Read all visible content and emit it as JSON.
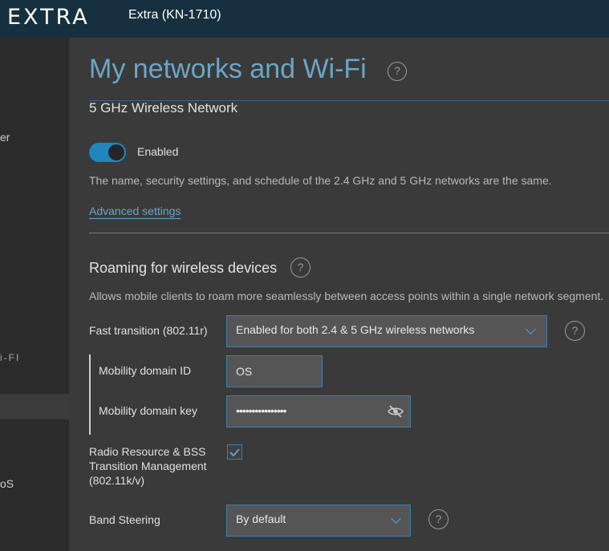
{
  "header": {
    "logo": "EXTRA",
    "device": "Extra (KN-1710)"
  },
  "sidebar": {
    "items": [
      {
        "label": "er"
      },
      {
        "label": "i-FI"
      },
      {
        "label": "oS"
      }
    ]
  },
  "page": {
    "title": "My networks and Wi-Fi",
    "help_icon": "?",
    "subtitle": "5 GHz Wireless Network"
  },
  "network": {
    "enabled": true,
    "toggle_label": "Enabled",
    "note": "The name, security settings, and schedule of the 2.4 GHz and 5 GHz networks are the same.",
    "advanced_link": "Advanced settings"
  },
  "roaming": {
    "title": "Roaming for wireless devices",
    "description": "Allows mobile clients to roam more seamlessly between access points within a single network segment.",
    "fast_transition": {
      "label": "Fast transition (802.11r)",
      "value": "Enabled for both 2.4 & 5 GHz wireless networks"
    },
    "mobility_domain_id": {
      "label": "Mobility domain ID",
      "value": "OS"
    },
    "mobility_domain_key": {
      "label": "Mobility domain key",
      "value": "••••••••••••••••"
    },
    "rrm": {
      "label_line1": "Radio Resource & BSS",
      "label_line2": "Transition Management",
      "label_line3": "(802.11k/v)",
      "checked": true
    },
    "band_steering": {
      "label": "Band Steering",
      "value": "By default"
    }
  },
  "colors": {
    "accent": "#1f86c0",
    "title": "#6aa6c8",
    "header_bg": "#163040"
  }
}
